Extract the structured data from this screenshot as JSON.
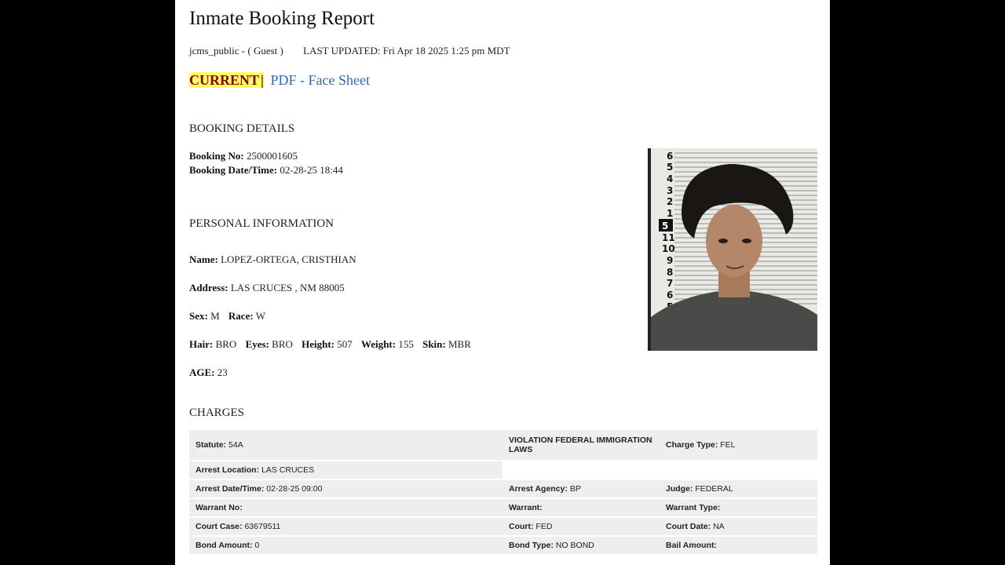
{
  "header": {
    "title": "Inmate Booking Report",
    "user": "jcms_public - ( Guest )",
    "last_updated": "LAST UPDATED: Fri Apr 18 2025 1:25 pm MDT"
  },
  "links": {
    "current": "CURRENT",
    "separator": "|",
    "pdf": "PDF - Face Sheet"
  },
  "booking": {
    "heading": "BOOKING DETAILS",
    "booking_no_label": "Booking No:",
    "booking_no": "2500001605",
    "datetime_label": "Booking Date/Time:",
    "datetime": "02-28-25 18:44"
  },
  "personal": {
    "heading": "PERSONAL INFORMATION",
    "name_label": "Name:",
    "name": "LOPEZ-ORTEGA, CRISTHIAN",
    "address_label": "Address:",
    "address": "LAS CRUCES , NM 88005",
    "sex_label": "Sex:",
    "sex": "M",
    "race_label": "Race:",
    "race": "W",
    "hair_label": "Hair:",
    "hair": "BRO",
    "eyes_label": "Eyes:",
    "eyes": "BRO",
    "height_label": "Height:",
    "height": "507",
    "weight_label": "Weight:",
    "weight": "155",
    "skin_label": "Skin:",
    "skin": "MBR",
    "age_label": "AGE:",
    "age": "23"
  },
  "photo": {
    "scale_numbers": [
      "6",
      "5",
      "4",
      "3",
      "2",
      "1",
      "5",
      "11",
      "10",
      "9",
      "8",
      "7",
      "6",
      "5"
    ]
  },
  "charges": {
    "heading": "CHARGES",
    "statute_label": "Statute:",
    "statute": "54A",
    "description": "VIOLATION FEDERAL IMMIGRATION LAWS",
    "charge_type_label": "Charge Type:",
    "charge_type": "FEL",
    "arrest_location_label": "Arrest Location:",
    "arrest_location": "LAS CRUCES",
    "arrest_datetime_label": "Arrest Date/Time:",
    "arrest_datetime": "02-28-25 09:00",
    "arrest_agency_label": "Arrest Agency:",
    "arrest_agency": "BP",
    "judge_label": "Judge:",
    "judge": "FEDERAL",
    "warrant_no_label": "Warrant No:",
    "warrant_no": "",
    "warrant_label": "Warrant:",
    "warrant": "",
    "warrant_type_label": "Warrant Type:",
    "warrant_type": "",
    "court_case_label": "Court Case:",
    "court_case": "63679511",
    "court_label": "Court:",
    "court": "FED",
    "court_date_label": "Court Date:",
    "court_date": "NA",
    "bond_amount_label": "Bond Amount:",
    "bond_amount": "0",
    "bond_type_label": "Bond Type:",
    "bond_type": "NO BOND",
    "bail_amount_label": "Bail Amount:",
    "bail_amount": ""
  }
}
